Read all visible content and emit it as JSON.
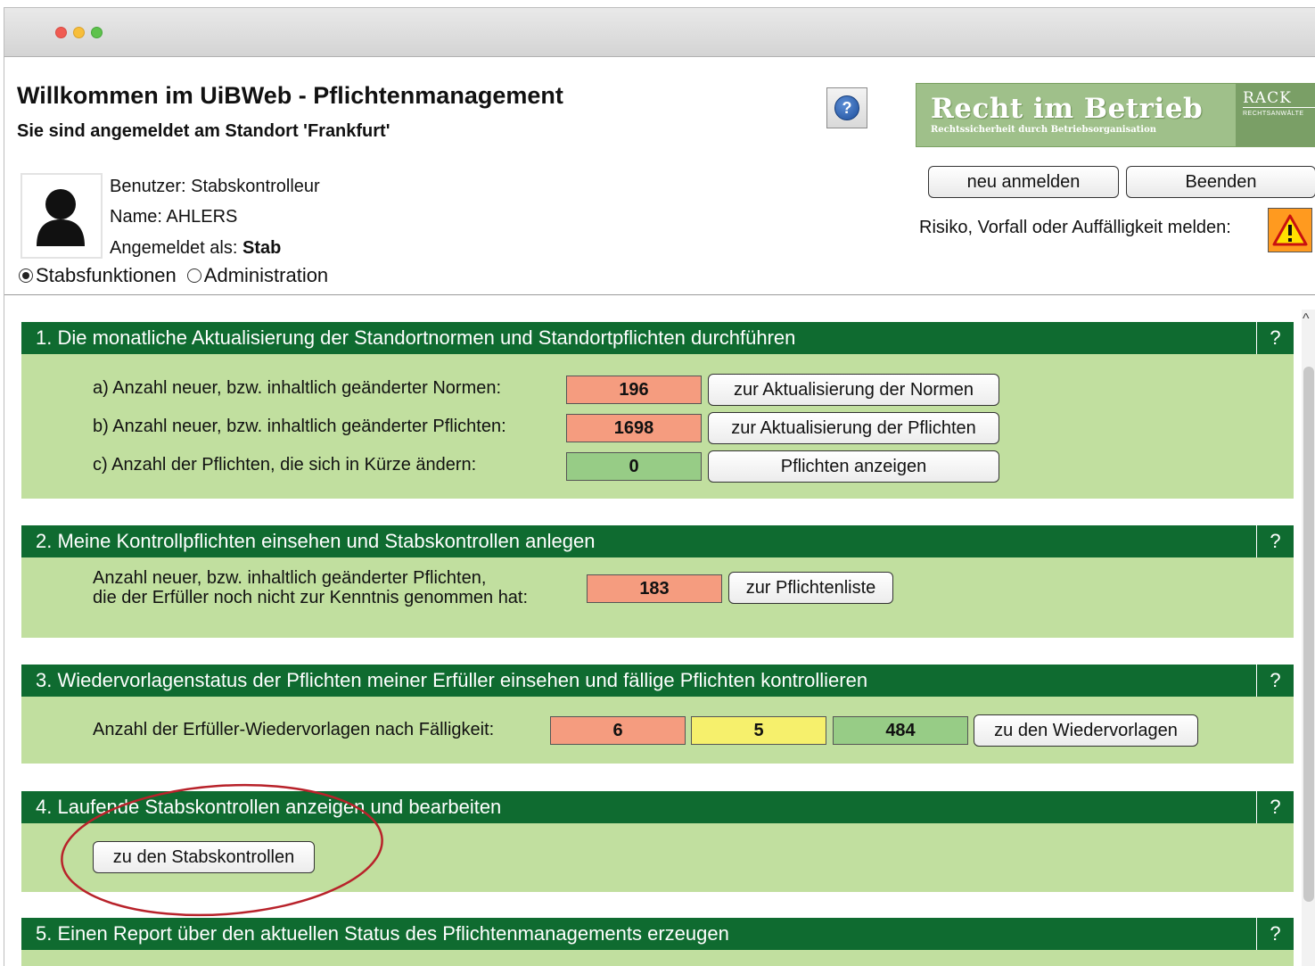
{
  "header": {
    "title": "Willkommen im UiBWeb - Pflichtenmanagement",
    "subtitle": "Sie sind angemeldet am Standort 'Frankfurt'",
    "help_label": "?"
  },
  "logo": {
    "main": "Recht im Betrieb",
    "sub": "Rechtssicherheit durch Betriebsorganisation",
    "brand": "RACK",
    "brand_sub": "RECHTSANWÄLTE"
  },
  "buttons": {
    "relogin": "neu anmelden",
    "quit": "Beenden"
  },
  "risk": {
    "label": "Risiko, Vorfall oder Auffälligkeit melden:",
    "icon": "warning-icon"
  },
  "user": {
    "benutzer": "Benutzer: Stabskontrolleur",
    "name": "Name: AHLERS",
    "role_prefix": "Angemeldet als: ",
    "role": "Stab"
  },
  "modes": {
    "options": [
      "Stabsfunktionen",
      "Administration"
    ],
    "selected": "Stabsfunktionen"
  },
  "colors": {
    "header_green": "#0f6b30",
    "panel_green": "#c1df9f",
    "red": "#f59c7f",
    "yellow": "#f6f06c",
    "green": "#97cc86"
  },
  "sections": [
    {
      "title": "1. Die monatliche Aktualisierung der Standortnormen und Standortpflichten durchführen",
      "help": "?",
      "rows": [
        {
          "label": "a) Anzahl neuer, bzw. inhaltlich geänderter Normen:",
          "value": "196",
          "status": "red",
          "button": "zur Aktualisierung der Normen"
        },
        {
          "label": "b) Anzahl neuer, bzw. inhaltlich geänderter Pflichten:",
          "value": "1698",
          "status": "red",
          "button": "zur Aktualisierung der Pflichten"
        },
        {
          "label": "c) Anzahl der Pflichten, die sich in Kürze ändern:",
          "value": "0",
          "status": "green",
          "button": "Pflichten anzeigen"
        }
      ]
    },
    {
      "title": "2. Meine Kontrollpflichten einsehen und Stabskontrollen anlegen",
      "help": "?",
      "label_line1": "Anzahl neuer, bzw. inhaltlich geänderter Pflichten,",
      "label_line2": "die der Erfüller noch nicht zur Kenntnis genommen hat:",
      "value": "183",
      "button": "zur Pflichtenliste"
    },
    {
      "title": "3. Wiedervorlagenstatus der Pflichten meiner Erfüller einsehen und fällige Pflichten kontrollieren",
      "help": "?",
      "label": "Anzahl der Erfüller-Wiedervorlagen nach Fälligkeit:",
      "values": [
        "6",
        "5",
        "484"
      ],
      "button": "zu den Wiedervorlagen"
    },
    {
      "title": "4. Laufende Stabskontrollen anzeigen und bearbeiten",
      "help": "?",
      "button": "zu den Stabskontrollen"
    },
    {
      "title": "5. Einen Report über den aktuellen Status des Pflichtenmanagements erzeugen",
      "help": "?"
    }
  ]
}
